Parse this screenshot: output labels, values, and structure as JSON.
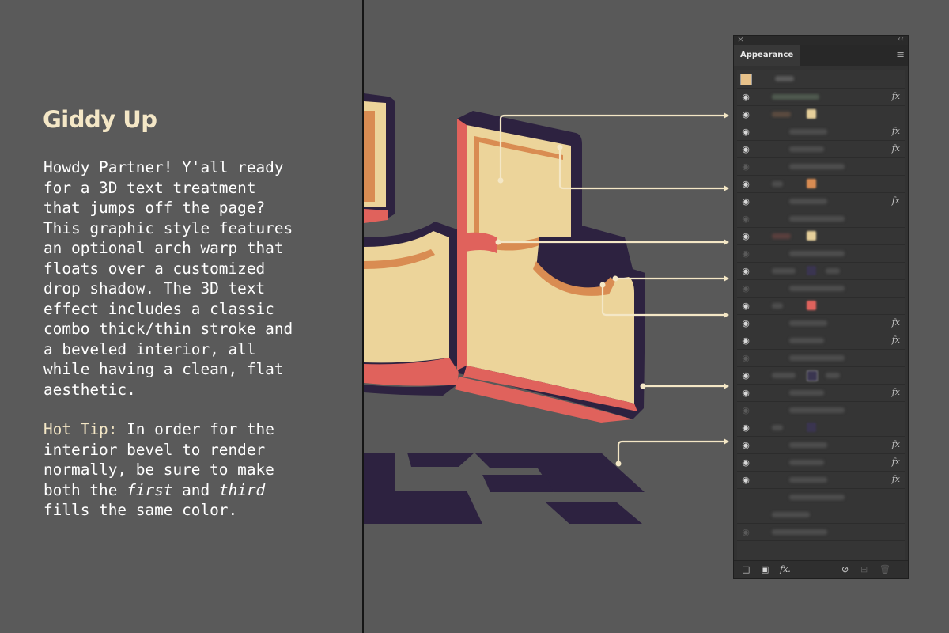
{
  "left": {
    "title": "Giddy Up",
    "paragraph_lines": [
      "Howdy Partner! Y'all ready",
      "for a 3D text treatment",
      "that jumps off the page?",
      "This graphic style features",
      "an optional arch warp that",
      "floats over a customized",
      "drop shadow. The 3D text",
      "effect includes a classic",
      "combo thick/thin stroke and",
      "a beveled interior, all",
      "while having a clean, flat",
      "aesthetic."
    ],
    "tip": {
      "label": "Hot Tip:",
      "line1": " In order for the",
      "line2": "interior bevel to render",
      "line3": "normally, be sure to make",
      "line4_a": "both the ",
      "line4_first": "first",
      "line4_b": " and ",
      "line4_third": "third",
      "line5": "fills the same color."
    }
  },
  "panel": {
    "tab_label": "Appearance",
    "close_glyph": "×",
    "collapse_glyph": "‹‹",
    "menu_glyph": "≡",
    "fx_glyph": "fx",
    "bottom_fx_glyph": "fx.",
    "colors": {
      "panel_bg": "#323232",
      "accent_cream": "#f4e7c6",
      "letter_face": "#ecd49a",
      "letter_side": "#e0625c",
      "outline": "#2d2240"
    }
  }
}
